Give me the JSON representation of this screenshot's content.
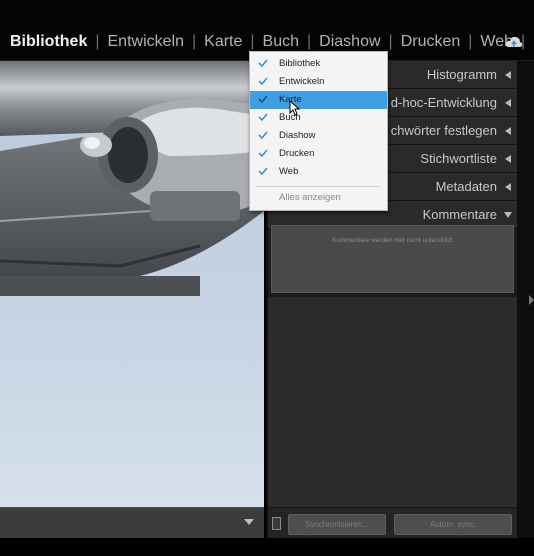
{
  "modules": [
    {
      "label": "Bibliothek",
      "active": true
    },
    {
      "label": "Entwickeln",
      "active": false
    },
    {
      "label": "Karte",
      "active": false
    },
    {
      "label": "Buch",
      "active": false
    },
    {
      "label": "Diashow",
      "active": false
    },
    {
      "label": "Drucken",
      "active": false
    },
    {
      "label": "Web",
      "active": false
    }
  ],
  "separator": "|",
  "menu": {
    "items": [
      {
        "label": "Bibliothek",
        "checked": true
      },
      {
        "label": "Entwickeln",
        "checked": true
      },
      {
        "label": "Karte",
        "checked": true,
        "highlighted": true
      },
      {
        "label": "Buch",
        "checked": true
      },
      {
        "label": "Diashow",
        "checked": true
      },
      {
        "label": "Drucken",
        "checked": true
      },
      {
        "label": "Web",
        "checked": true
      }
    ],
    "show_all": "Alles anzeigen"
  },
  "panels": {
    "histogram": "Histogramm",
    "quick_develop": "d-hoc-Entwicklung",
    "keywording": "chwörter festlegen",
    "keyword_list": "Stichwortliste",
    "metadata": "Metadaten",
    "comments": "Kommentare"
  },
  "comments_text": "Kommentare werden hier nicht unterstützt",
  "footer": {
    "sync_label": "Synchronisieren...",
    "autosync_label": "Autom. sync."
  },
  "colors": {
    "highlight": "#3f9fe3",
    "check": "#3f8fd8"
  }
}
